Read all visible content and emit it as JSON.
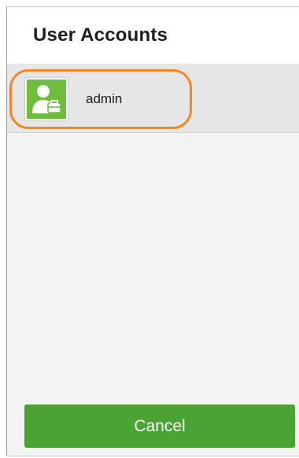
{
  "dialog": {
    "title": "User Accounts",
    "accounts": [
      {
        "name": "admin",
        "icon": "user-account-icon"
      }
    ],
    "cancel_label": "Cancel"
  },
  "colors": {
    "accent_green": "#4aa332",
    "avatar_green": "#6cbe3c",
    "highlight_orange": "#f0882b"
  }
}
